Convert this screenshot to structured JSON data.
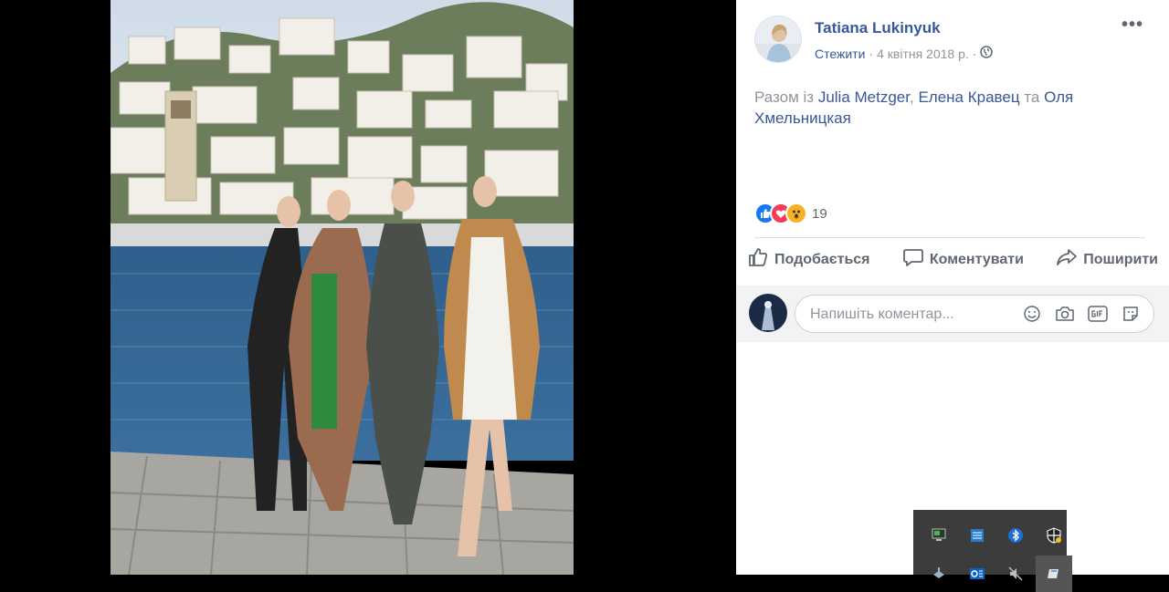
{
  "post": {
    "author": "Tatiana Lukinyuk",
    "follow": "Стежити",
    "separator": "·",
    "date": "4 квітня 2018 р.",
    "separator2": "·",
    "more": "•••",
    "caption": {
      "prefix": "Разом із",
      "tag1": "Julia Metzger",
      "comma": ",",
      "tag2": "Елена Кравец",
      "and": "та",
      "tag3": "Оля Хмельницкая"
    },
    "reactions": {
      "count": "19"
    },
    "actions": {
      "like": "Подобається",
      "comment": "Коментувати",
      "share": "Поширити"
    },
    "comment": {
      "placeholder": "Напишіть коментар..."
    }
  },
  "colors": {
    "accent": "#385898",
    "like": "#1877f2",
    "love": "#f33e58",
    "wow": "#f7b125",
    "tray": "#3c3c3c"
  },
  "icons": [
    "globe-icon",
    "like-icon",
    "comment-icon",
    "share-icon",
    "emoji-icon",
    "camera-icon",
    "gif-icon",
    "sticker-icon"
  ],
  "tray_icons": [
    "monitor-icon",
    "network-icon",
    "bluetooth-icon",
    "security-shield-icon",
    "usb-icon",
    "outlook-icon",
    "mute-icon",
    "app-icon"
  ]
}
